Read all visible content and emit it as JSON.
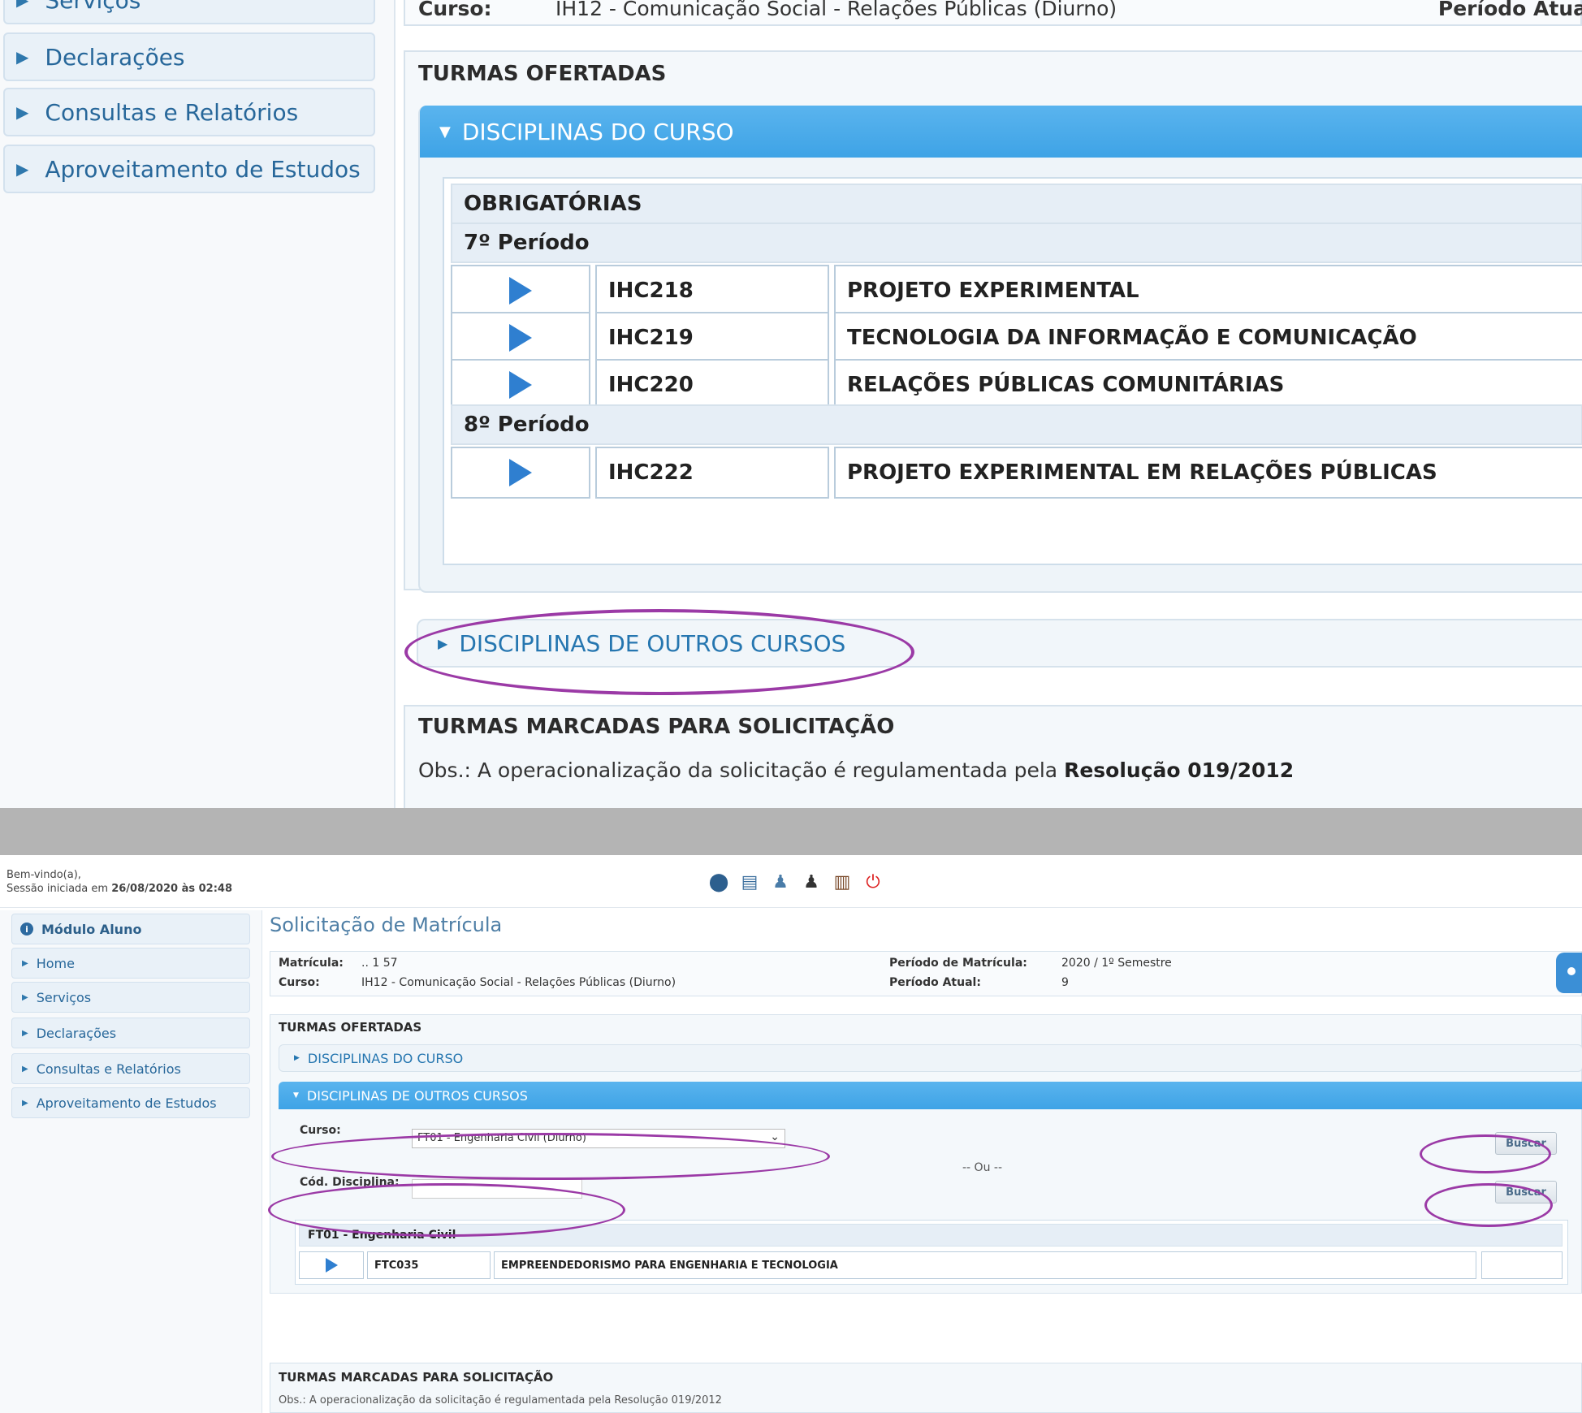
{
  "top": {
    "sidebar": [
      "Serviços",
      "Declarações",
      "Consultas e Relatórios",
      "Aproveitamento de Estudos"
    ],
    "course_label": "Curso:",
    "course_value": "IH12 - Comunicação Social - Relações Públicas (Diurno)",
    "periodo_label": "Período Atua",
    "ofertadas_title": "TURMAS OFERTADAS",
    "disc_curso": "DISCIPLINAS DO CURSO",
    "obrigatorias": "OBRIGATÓRIAS",
    "periodo7": "7º Período",
    "periodo8": "8º Período",
    "rows": [
      {
        "code": "IHC218",
        "name": "PROJETO EXPERIMENTAL"
      },
      {
        "code": "IHC219",
        "name": "TECNOLOGIA DA INFORMAÇÃO E COMUNICAÇÃO"
      },
      {
        "code": "IHC220",
        "name": "RELAÇÕES PÚBLICAS COMUNITÁRIAS"
      },
      {
        "code": "IHC222",
        "name": "PROJETO EXPERIMENTAL EM RELAÇÕES PÚBLICAS"
      }
    ],
    "disc_outros": "DISCIPLINAS DE OUTROS CURSOS",
    "marcadas_title": "TURMAS MARCADAS PARA SOLICITAÇÃO",
    "obs_prefix": "Obs.: A operacionalização da solicitação é regulamentada pela ",
    "obs_bold": "Resolução 019/2012"
  },
  "bottom": {
    "welcome_line1": "Bem-vindo(a),",
    "welcome_line2_prefix": "Sessão iniciada em ",
    "welcome_line2_date": "26/08/2020 às 02:48",
    "sidebar_head": "Módulo Aluno",
    "sidebar": [
      "Home",
      "Serviços",
      "Declarações",
      "Consultas e Relatórios",
      "Aproveitamento de Estudos"
    ],
    "page_title": "Solicitação de Matrícula",
    "matricula_label": "Matrícula:",
    "matricula_value": ".. 1 57",
    "curso_label": "Curso:",
    "curso_value": "IH12 - Comunicação Social - Relações Públicas (Diurno)",
    "periodo_matricula_label": "Período de Matrícula:",
    "periodo_matricula_value": "2020 / 1º Semestre",
    "periodo_atual_label": "Período Atual:",
    "periodo_atual_value": "9",
    "ofertadas_title": "TURMAS OFERTADAS",
    "disc_curso": "DISCIPLINAS DO CURSO",
    "disc_outros": "DISCIPLINAS DE OUTROS CURSOS",
    "curso_field_label": "Curso:",
    "curso_select_value": "FT01 - Engenharia Civil (Diurno)",
    "buscar": "Buscar",
    "ou": "-- Ou --",
    "cod_label": "Cód. Disciplina:",
    "result_head": "FT01 - Engenharia Civil",
    "result_code": "FTC035",
    "result_name": "EMPREENDEDORISMO PARA ENGENHARIA E TECNOLOGIA",
    "marcadas_title": "TURMAS MARCADAS PARA SOLICITAÇÃO",
    "marcadas_obs": "Obs.: A operacionalização da solicitação é regulamentada pela Resolução 019/2012"
  },
  "colors": {
    "accent_blue": "#3ea3e6",
    "annotation_purple": "#9b3aa6",
    "link_blue": "#2576b0"
  },
  "icons": [
    "home-icon",
    "document-icon",
    "user-icon",
    "user-dark-icon",
    "books-icon",
    "logout-icon"
  ]
}
